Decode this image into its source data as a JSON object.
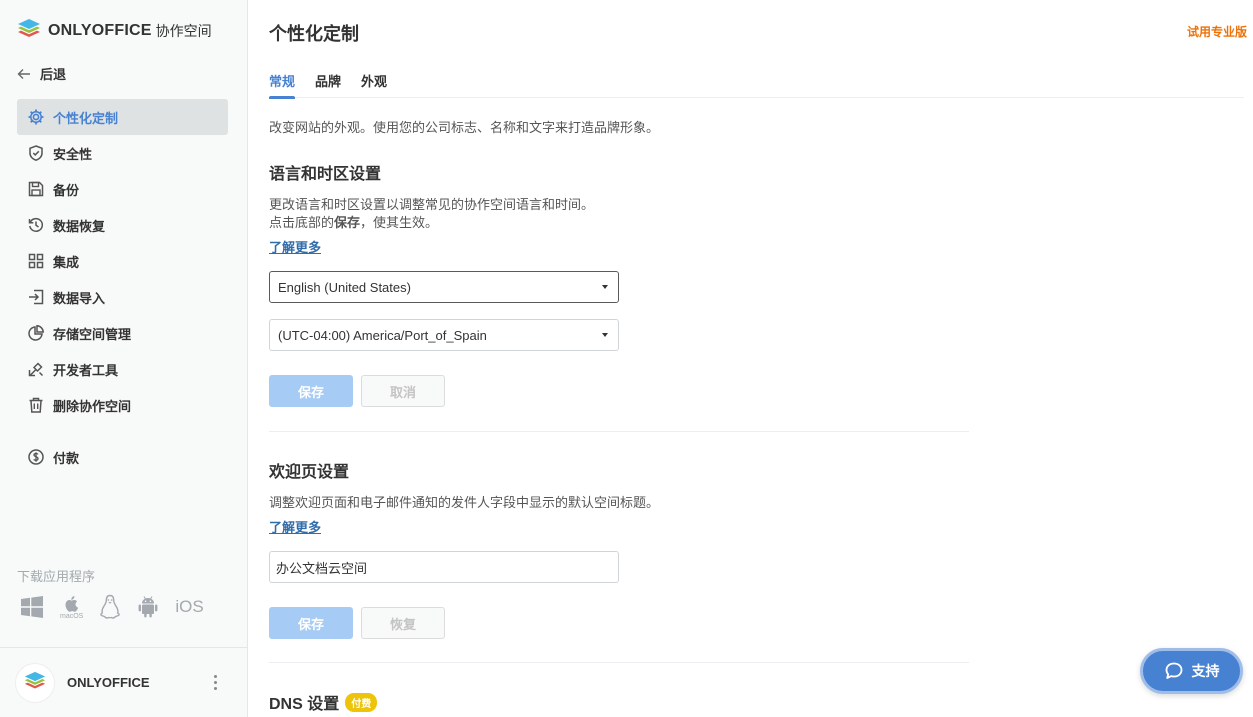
{
  "sidebar": {
    "logo": {
      "brand": "ONLYOFFICE",
      "product": "协作空间"
    },
    "back_label": "后退",
    "items": [
      {
        "label": "个性化定制",
        "icon": "gear-icon",
        "active": true
      },
      {
        "label": "安全性",
        "icon": "shield-icon"
      },
      {
        "label": "备份",
        "icon": "floppy-disk-icon"
      },
      {
        "label": "数据恢复",
        "icon": "history-icon"
      },
      {
        "label": "集成",
        "icon": "grid-icon"
      },
      {
        "label": "数据导入",
        "icon": "import-icon"
      },
      {
        "label": "存储空间管理",
        "icon": "pie-chart-icon"
      },
      {
        "label": "开发者工具",
        "icon": "developer-tools-icon"
      },
      {
        "label": "删除协作空间",
        "icon": "trash-icon"
      },
      {
        "label": "付款",
        "icon": "dollar-circle-icon"
      }
    ],
    "download": {
      "title": "下载应用程序",
      "apps": [
        "windows-icon",
        "macos-icon",
        "linux-icon",
        "android-icon"
      ],
      "macos_label": "macOS",
      "ios_label": "iOS"
    },
    "profile": {
      "name": "ONLYOFFICE"
    }
  },
  "main": {
    "title": "个性化定制",
    "trial_link": "试用专业版",
    "tabs": [
      {
        "label": "常规",
        "active": true
      },
      {
        "label": "品牌"
      },
      {
        "label": "外观"
      }
    ],
    "intro": "改变网站的外观。使用您的公司标志、名称和文字来打造品牌形象。",
    "language": {
      "heading": "语言和时区设置",
      "desc_line1": "更改语言和时区设置以调整常见的协作空间语言和时间。",
      "desc_line2_prefix": "点击底部的",
      "desc_line2_bold": "保存",
      "desc_line2_suffix": "，使其生效。",
      "learn_more": "了解更多",
      "language_value": "English (United States)",
      "timezone_value": "(UTC-04:00) America/Port_of_Spain",
      "save_label": "保存",
      "cancel_label": "取消"
    },
    "welcome": {
      "heading": "欢迎页设置",
      "desc": "调整欢迎页面和电子邮件通知的发件人字段中显示的默认空间标题。",
      "learn_more": "了解更多",
      "title_value": "办公文档云空间",
      "save_label": "保存",
      "restore_label": "恢复"
    },
    "dns": {
      "heading": "DNS 设置",
      "badge": "付费"
    }
  },
  "support": {
    "label": "支持"
  },
  "colors": {
    "accent": "#4781d1",
    "trial": "#ed7309",
    "badge": "#edc409",
    "button_disabled": "#a6cbf5"
  }
}
